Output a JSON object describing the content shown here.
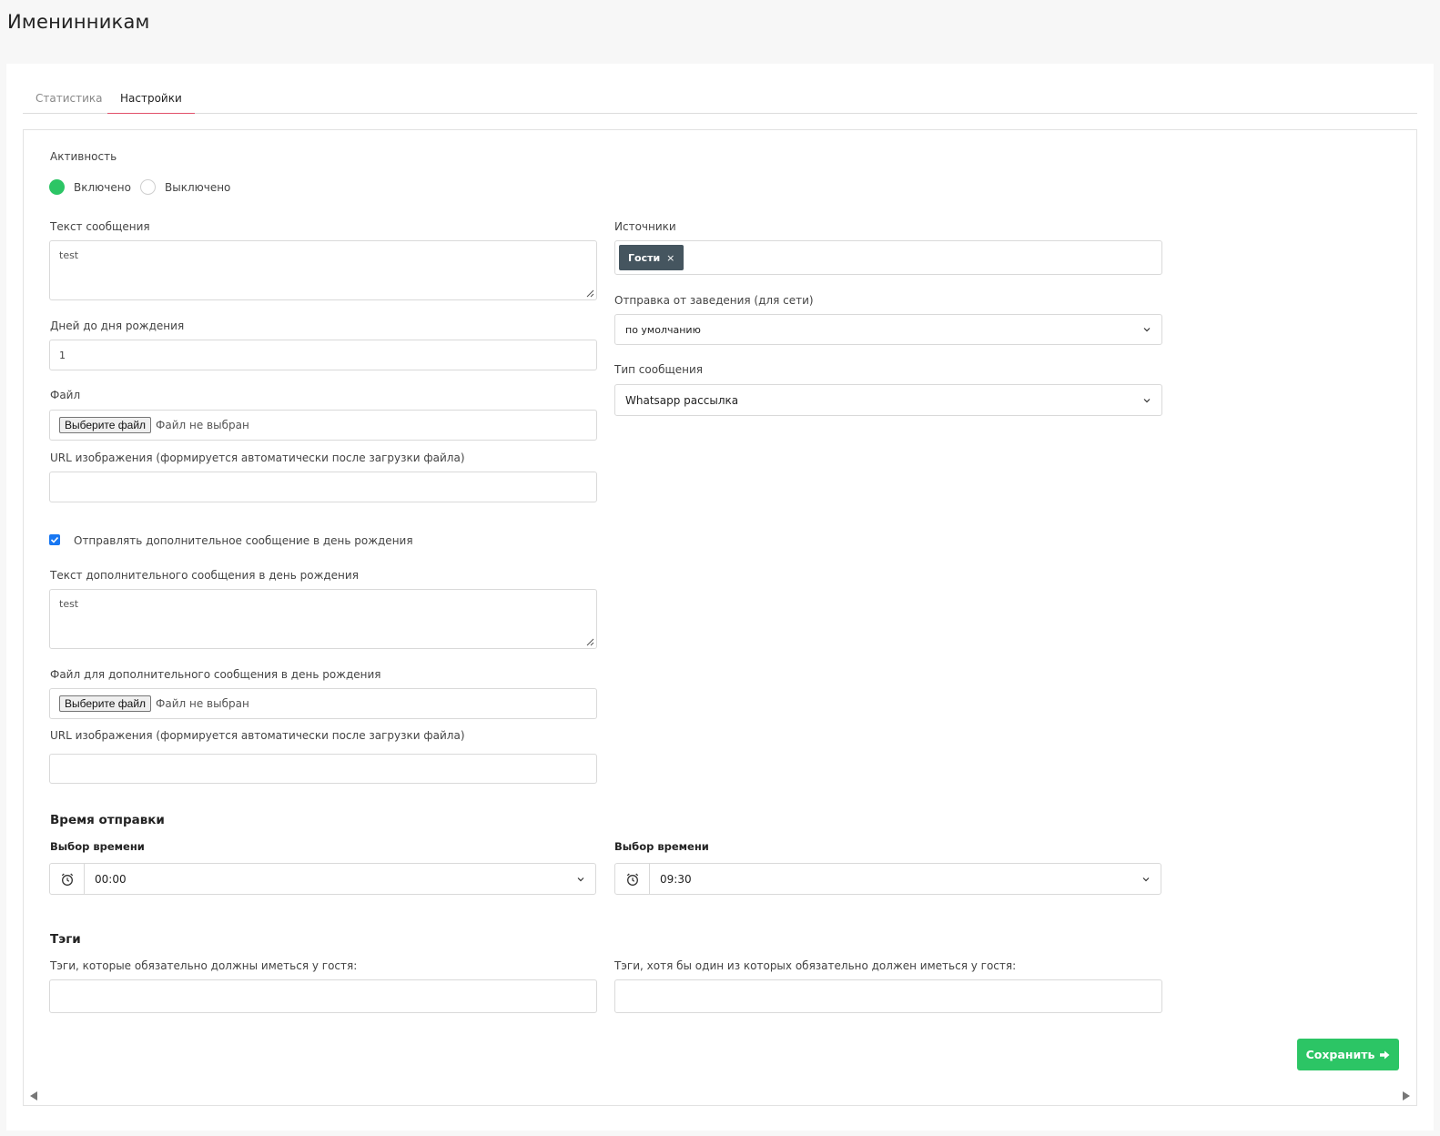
{
  "page": {
    "title": "Именинникам"
  },
  "tabs": [
    {
      "label": "Статистика",
      "active": false
    },
    {
      "label": "Настройки",
      "active": true
    }
  ],
  "activity": {
    "label": "Активность",
    "on_label": "Включено",
    "off_label": "Выключено",
    "selected": "Включено"
  },
  "message": {
    "label": "Текст сообщения",
    "value": "test"
  },
  "days": {
    "label": "Дней до дня рождения",
    "value": "1"
  },
  "file": {
    "label": "Файл",
    "button": "Выберите файл",
    "status": "Файл не выбран"
  },
  "image_url": {
    "label": "URL изображения (формируется автоматически после загрузки файла)",
    "value": ""
  },
  "sources": {
    "label": "Источники",
    "tags": [
      "Гости"
    ],
    "remove_glyph": "×"
  },
  "sender": {
    "label": "Отправка от заведения (для сети)",
    "value": "по умолчанию"
  },
  "message_type": {
    "label": "Тип сообщения",
    "value": "Whatsapp рассылка"
  },
  "extra": {
    "checkbox_label": "Отправлять дополнительное сообщение в день рождения",
    "checked": true,
    "text_label": "Текст дополнительного сообщения в день рождения",
    "text_value": "test",
    "file_label": "Файл для дополнительного сообщения в день рождения",
    "file_button": "Выберите файл",
    "file_status": "Файл не выбран",
    "url_label": "URL изображения (формируется автоматически после загрузки файла)",
    "url_value": ""
  },
  "send_time": {
    "heading": "Время отправки",
    "left_label": "Выбор времени",
    "left_value": "00:00",
    "right_label": "Выбор времени",
    "right_value": "09:30"
  },
  "tags": {
    "heading": "Тэги",
    "required_label": "Тэги, которые обязательно должны иметься у гостя:",
    "required_value": "",
    "any_label": "Тэги, хотя бы один из которых обязательно должен иметься у гостя:",
    "any_value": ""
  },
  "actions": {
    "save_label": "Сохранить"
  },
  "colors": {
    "accent_green": "#2cc565",
    "tab_underline": "#e2506a",
    "chip_bg": "#45555f",
    "checkbox_blue": "#1877f2"
  }
}
